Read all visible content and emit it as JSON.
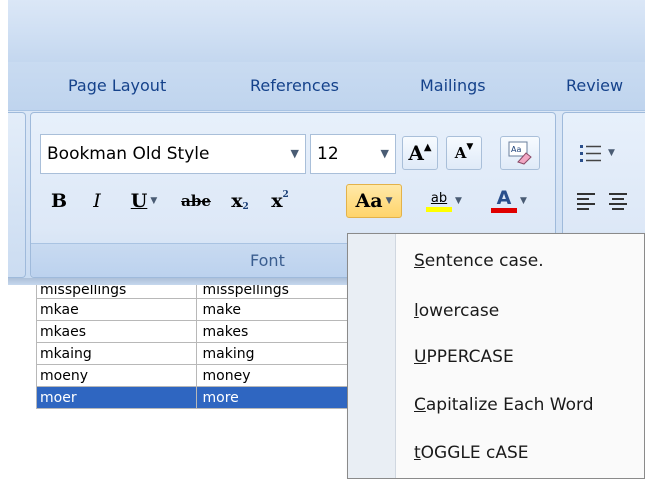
{
  "ribbon": {
    "tabs": [
      {
        "label": "Page Layout"
      },
      {
        "label": "References"
      },
      {
        "label": "Mailings"
      },
      {
        "label": "Review"
      }
    ],
    "font_group": {
      "label": "Font",
      "font_name": "Bookman Old Style",
      "font_size": "12",
      "grow_font": "A",
      "shrink_font": "A",
      "bold": "B",
      "italic": "I",
      "underline": "U",
      "strikethrough": "abe",
      "subscript": "x",
      "superscript": "x",
      "change_case": "Aa",
      "font_color": "A",
      "highlight_text": "ab"
    },
    "colors": {
      "highlight": "#ffff00",
      "font_color": "#e00000",
      "selection": "#2f66c1"
    }
  },
  "table": {
    "partial_row": [
      "misspellings",
      "misspellings"
    ],
    "rows": [
      [
        "mkae",
        "make"
      ],
      [
        "mkaes",
        "makes"
      ],
      [
        "mkaing",
        "making"
      ],
      [
        "moeny",
        "money"
      ],
      [
        "moer",
        "more"
      ]
    ],
    "selected_index": 4
  },
  "change_case_menu": {
    "items": [
      {
        "accel": "S",
        "rest": "entence case."
      },
      {
        "accel": "l",
        "rest": "owercase"
      },
      {
        "accel": "U",
        "rest": "PPERCASE"
      },
      {
        "accel": "C",
        "rest": "apitalize Each Word"
      },
      {
        "accel": "t",
        "rest": "OGGLE cASE"
      }
    ]
  }
}
